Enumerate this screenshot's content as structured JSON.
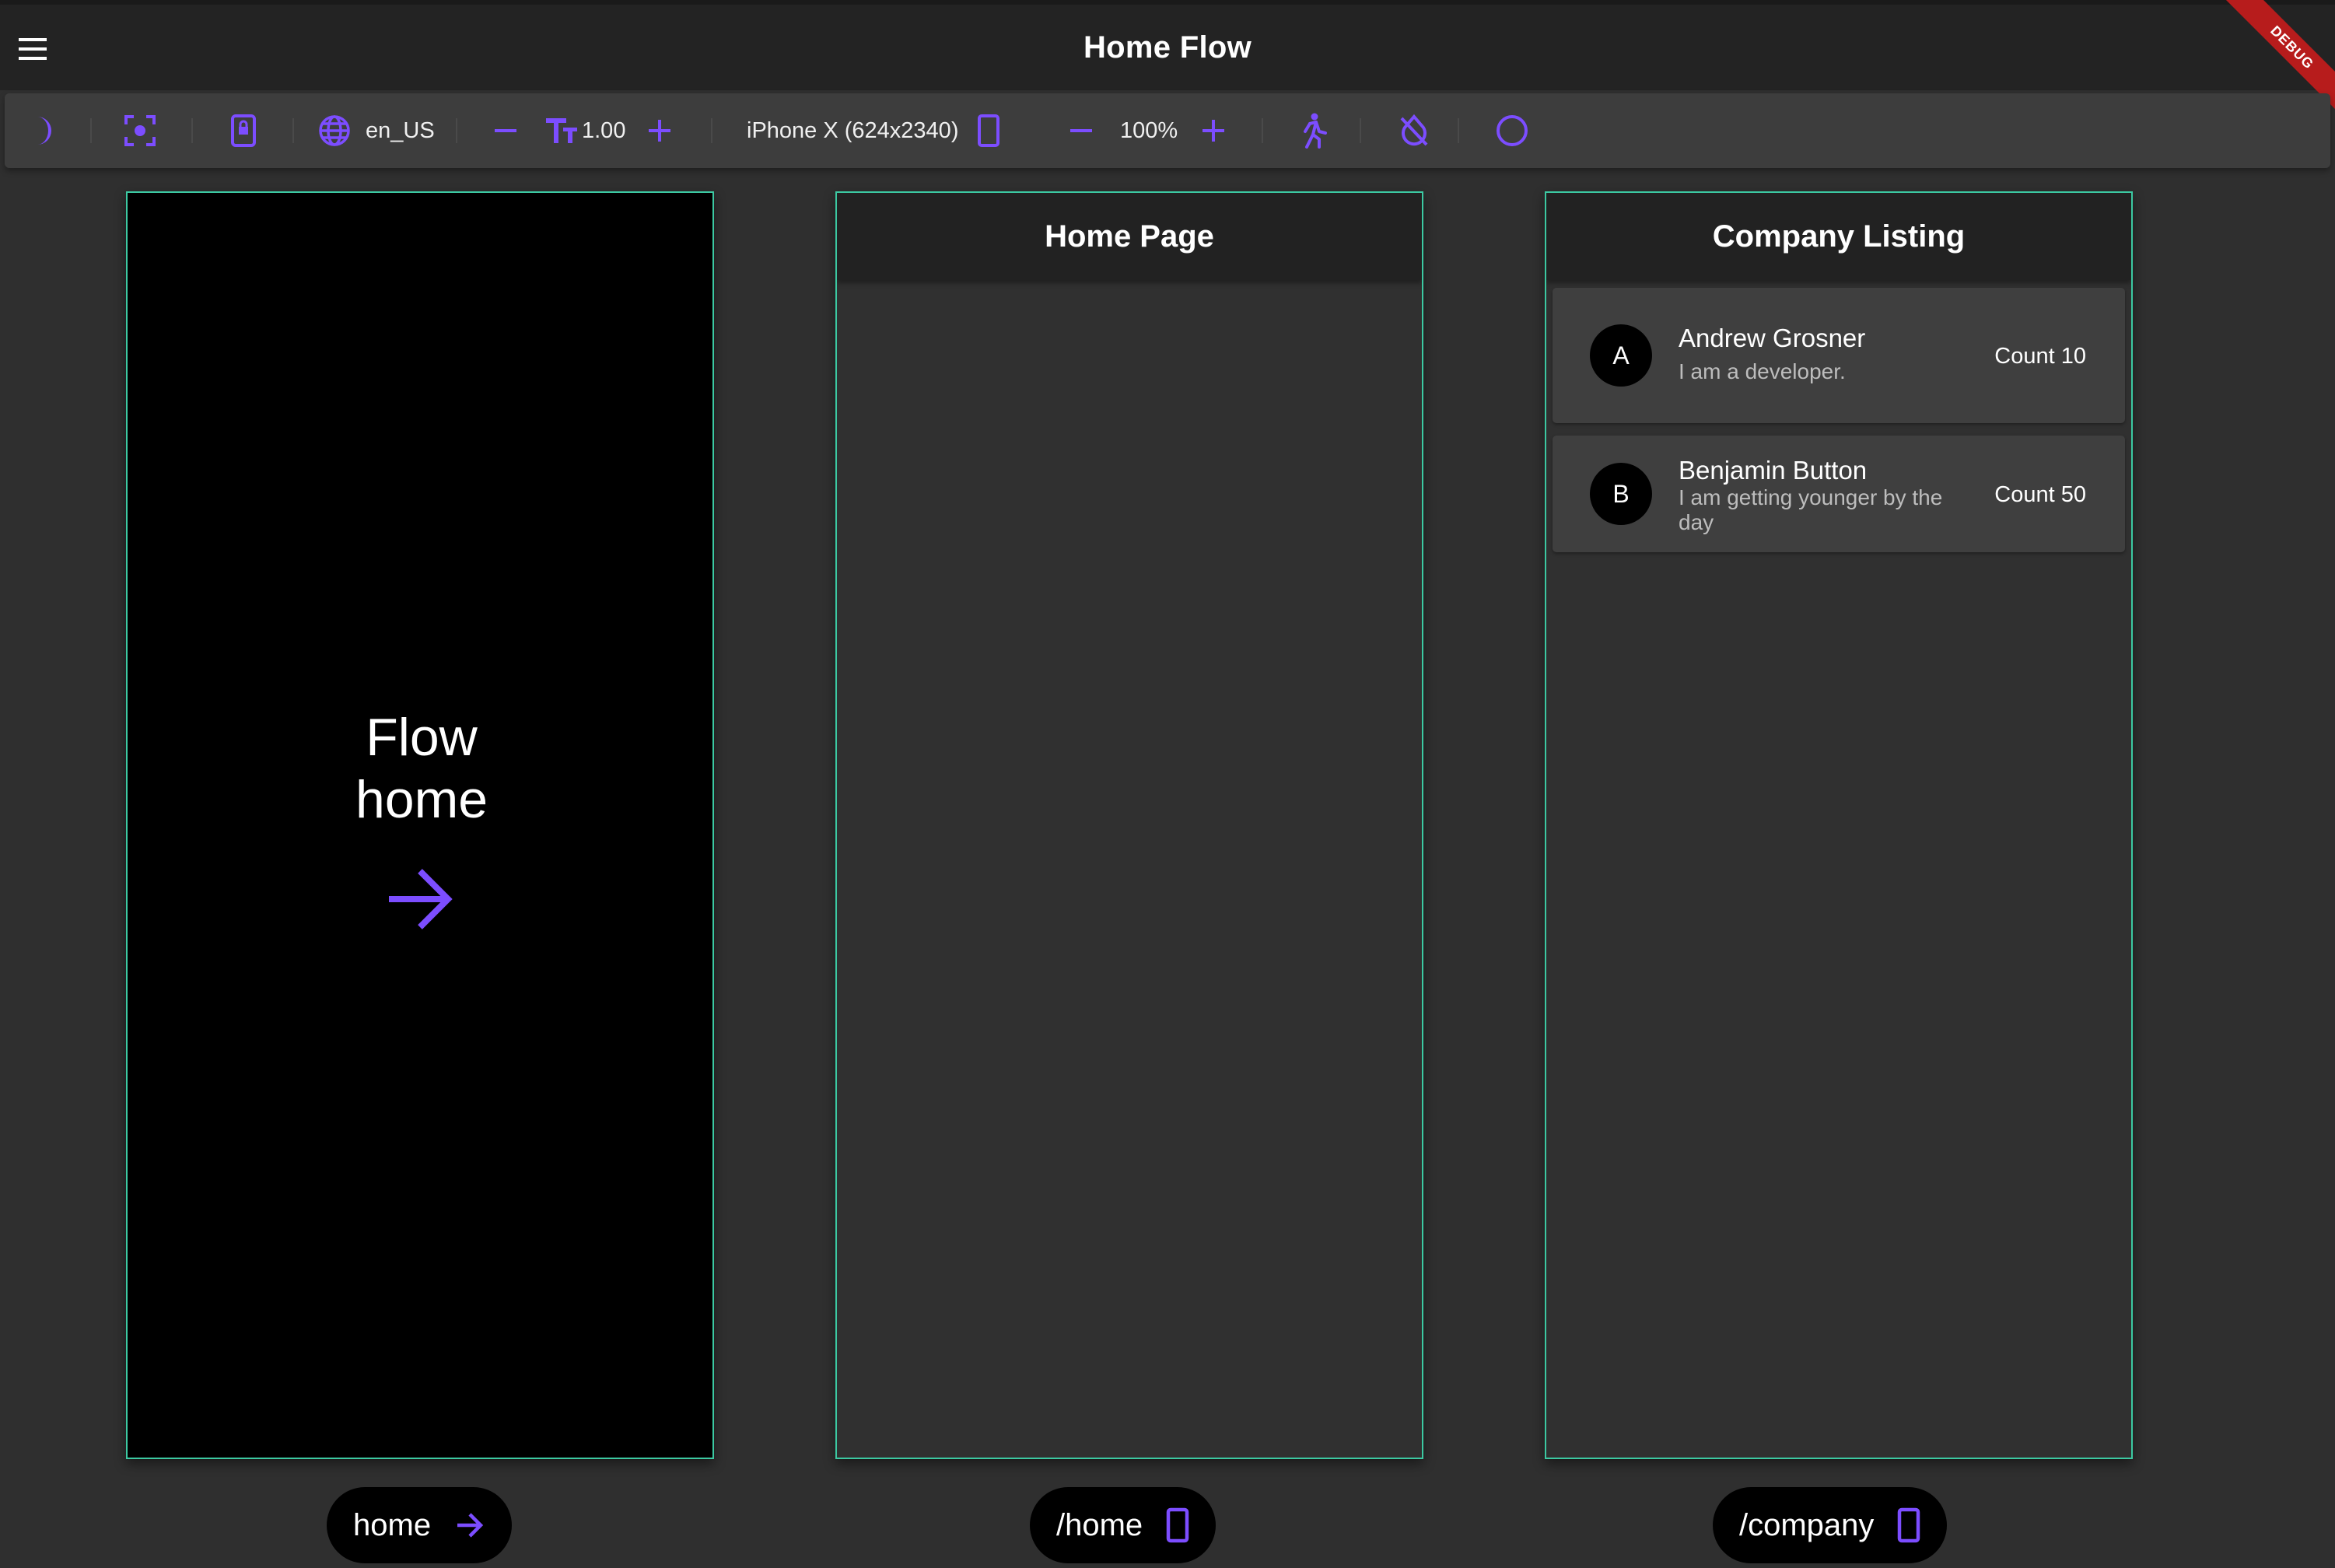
{
  "app_bar": {
    "title": "Home Flow",
    "debug_banner": "DEBUG"
  },
  "toolbar": {
    "locale": "en_US",
    "text_scale": "1.00",
    "device": "iPhone X (624x2340)",
    "zoom": "100%"
  },
  "frames": {
    "flow": {
      "text": "Flow home"
    },
    "home": {
      "header": "Home Page"
    },
    "company": {
      "header": "Company Listing",
      "items": [
        {
          "initial": "A",
          "name": "Andrew Grosner",
          "description": "I am a developer.",
          "count": "Count 10"
        },
        {
          "initial": "B",
          "name": "Benjamin Button",
          "description": "I am getting younger by the day",
          "count": "Count 50"
        }
      ]
    }
  },
  "routes": [
    {
      "label": "home",
      "icon": "arrow-right-icon"
    },
    {
      "label": "/home",
      "icon": "phone-icon"
    },
    {
      "label": "/company",
      "icon": "phone-icon"
    }
  ],
  "colors": {
    "accent": "#7c4dff",
    "frame_border": "#3cc9a2",
    "debug_banner": "#b71c1c"
  }
}
